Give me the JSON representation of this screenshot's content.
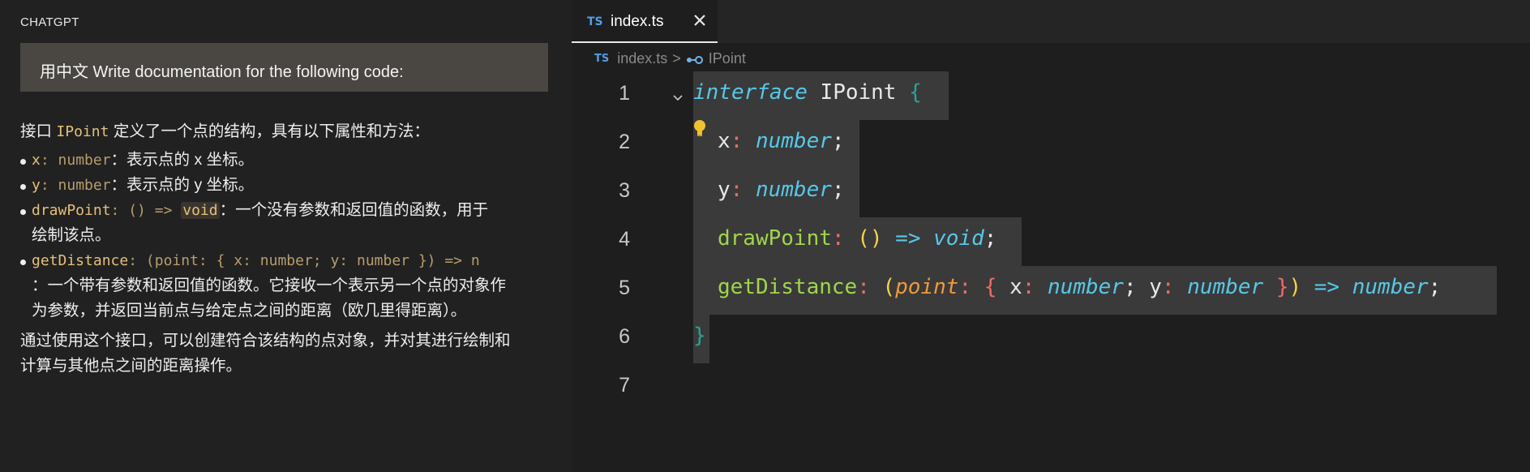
{
  "left_panel": {
    "title": "CHATGPT",
    "prompt": "用中文 Write documentation for the following code:",
    "answer": {
      "intro_prefix": "接口 ",
      "intro_code": "IPoint",
      "intro_suffix": " 定义了一个点的结构，具有以下属性和方法：",
      "items": [
        {
          "code": "x",
          "code_tail": ": number",
          "text": "：表示点的 x 坐标。"
        },
        {
          "code": "y",
          "code_tail": ": number",
          "text": "：表示点的 y 坐标。"
        },
        {
          "code": "drawPoint",
          "code_tail": ": () => ",
          "code_box": "void",
          "text": "：一个没有参数和返回值的函数，用于",
          "text2": "绘制该点。"
        },
        {
          "code": "getDistance",
          "code_tail": ": (point: { x: number; y: number }) => n",
          "text": "：一个带有参数和返回值的函数。它接收一个表示另一个点的对象作",
          "text2": "为参数，并返回当前点与给定点之间的距离（欧几里得距离）。"
        }
      ],
      "conclusion_line1": "通过使用这个接口，可以创建符合该结构的点对象，并对其进行绘制和",
      "conclusion_line2": "计算与其他点之间的距离操作。"
    }
  },
  "editor": {
    "tab": {
      "lang_badge": "TS",
      "filename": "index.ts",
      "close_icon": "close-icon"
    },
    "breadcrumb": {
      "lang_badge": "TS",
      "file": "index.ts",
      "separator": ">",
      "symbol_icon": "interface-symbol-icon",
      "symbol": "IPoint"
    },
    "line_numbers": [
      "1",
      "2",
      "3",
      "4",
      "5",
      "6",
      "7"
    ],
    "code": {
      "l1_kw": "interface",
      "l1_name": " IPoint ",
      "l1_brace": "{",
      "l2_prop": "x",
      "l2_type": "number",
      "l3_prop": "y",
      "l3_type": "number",
      "l4_fn": "drawPoint",
      "l4_parens": "()",
      "l4_arrow": "=>",
      "l4_ret": "void",
      "l5_fn": "getDistance",
      "l5_open": "(",
      "l5_param": "point",
      "l5_obrace": "{",
      "l5_x": "x",
      "l5_xt": "number",
      "l5_y": "y",
      "l5_yt": "number",
      "l5_cbrace": "}",
      "l5_close": ")",
      "l5_arrow": "=>",
      "l5_ret": "number",
      "l6_brace": "}",
      "colon": ":",
      "semi": ";"
    },
    "colors": {
      "keyword": "#56c8e8",
      "function": "#9fd64a",
      "param": "#f09a3a",
      "colon": "#f06a6a",
      "paren": "#f5d547",
      "ts_badge": "#4e9fe6"
    },
    "lightbulb_icon": "lightbulb-icon"
  }
}
